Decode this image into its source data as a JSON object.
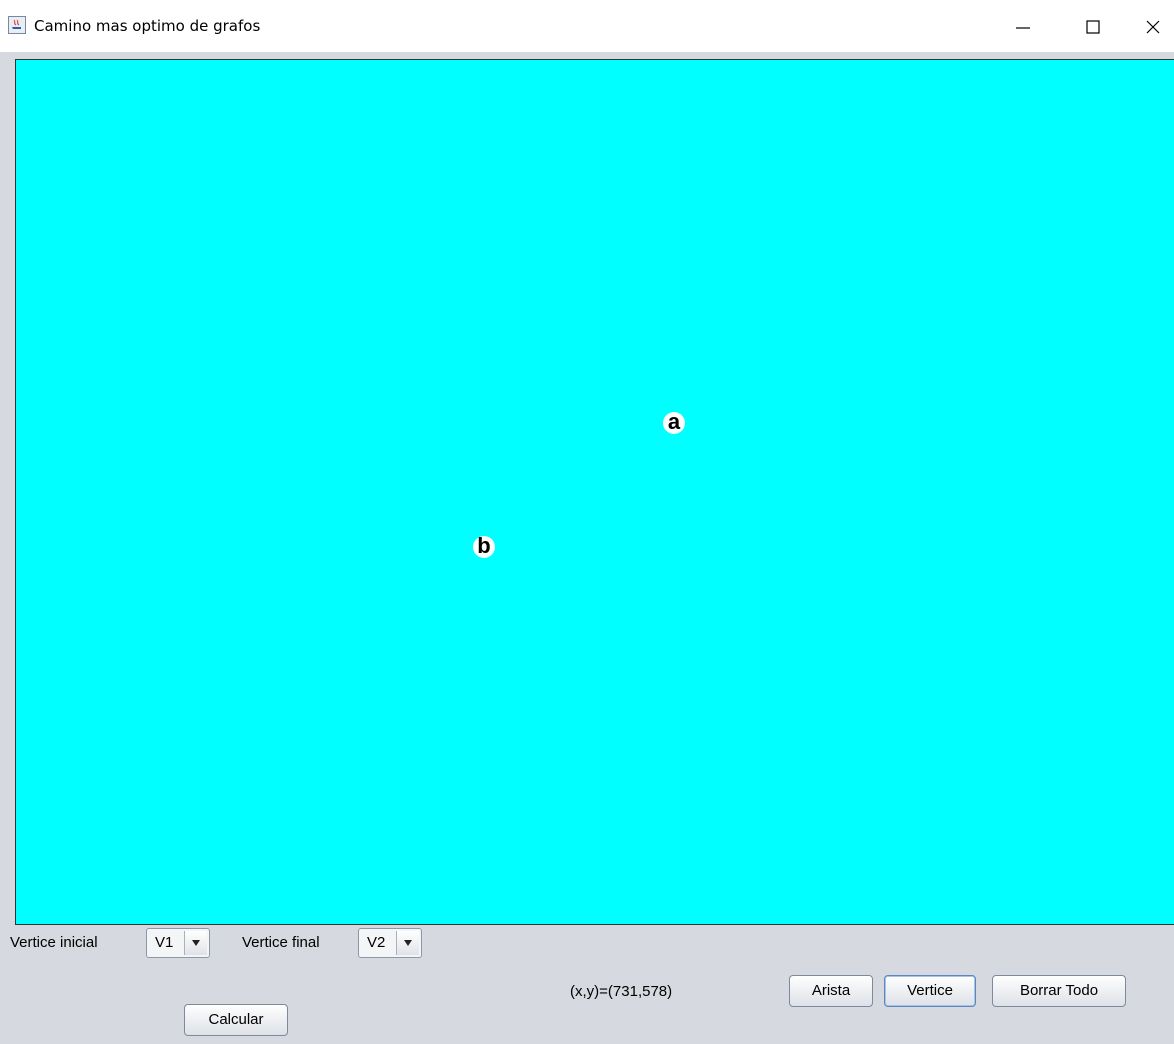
{
  "window": {
    "title": "Camino mas optimo de grafos",
    "controls": [
      "minimize",
      "maximize",
      "close"
    ]
  },
  "canvas": {
    "background": "#00ffff",
    "vertices": [
      "a",
      "b"
    ]
  },
  "controls": {
    "start_label": "Vertice inicial",
    "start_value": "V1",
    "end_label": "Vertice final",
    "end_value": "V2",
    "coords": "(x,y)=(731,578)",
    "calcular": "Calcular",
    "arista": "Arista",
    "vertice": "Vertice",
    "borrar": "Borrar Todo"
  },
  "icons": {
    "app": "java-app-icon",
    "minimize": "minimize-icon",
    "maximize": "maximize-icon",
    "close": "close-icon",
    "dropdown": "chevron-down-icon"
  }
}
